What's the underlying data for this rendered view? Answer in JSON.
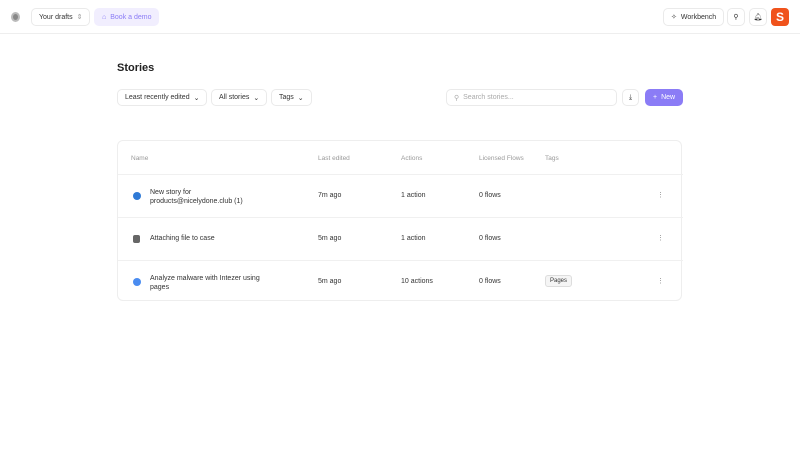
{
  "topbar": {
    "drafts": "Your drafts",
    "demo": "Book a demo",
    "workbench": "Workbench"
  },
  "page": {
    "title": "Stories"
  },
  "filters": {
    "sort": "Least recently edited",
    "scope": "All stories",
    "tags": "Tags",
    "search_placeholder": "Search stories...",
    "new": "New"
  },
  "table": {
    "headers": [
      "Name",
      "Last edited",
      "Actions",
      "Licensed Flows",
      "Tags"
    ],
    "rows": [
      {
        "name1": "New story for",
        "name2": "products@nicelydone.club (1)",
        "edited": "7m ago",
        "actions": "1 action",
        "flows": "0 flows",
        "tag": ""
      },
      {
        "name1": "Attaching file to case",
        "name2": "",
        "edited": "5m ago",
        "actions": "1 action",
        "flows": "0 flows",
        "tag": ""
      },
      {
        "name1": "Analyze malware with Intezer using",
        "name2": "pages",
        "edited": "5m ago",
        "actions": "10 actions",
        "flows": "0 flows",
        "tag": "Pages"
      }
    ]
  },
  "colors": {
    "accent": "#8b7cf6",
    "brand": "#f0531c"
  }
}
